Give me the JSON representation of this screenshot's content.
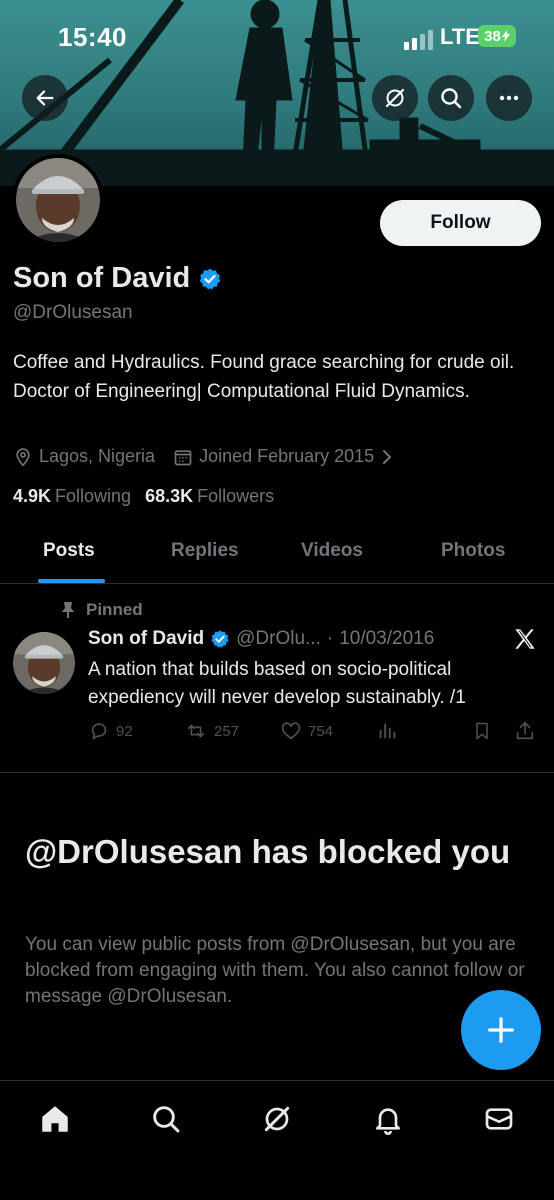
{
  "status_bar": {
    "time": "15:40",
    "network": "LTE",
    "battery": "38"
  },
  "header": {
    "back_icon": "arrow-left-icon",
    "grok_icon": "grok-icon",
    "search_icon": "search-icon",
    "more_icon": "more-horizontal-icon"
  },
  "profile": {
    "name": "Son of David",
    "handle": "@DrOlusesan",
    "follow_label": "Follow",
    "bio": "Coffee and Hydraulics. Found grace searching for crude oil. Doctor of Engineering| Computational Fluid Dynamics.",
    "location": "Lagos, Nigeria",
    "joined": "Joined February 2015",
    "following_count": "4.9K",
    "following_label": "Following",
    "followers_count": "68.3K",
    "followers_label": "Followers"
  },
  "tabs": [
    {
      "label": "Posts",
      "active": true
    },
    {
      "label": "Replies",
      "active": false
    },
    {
      "label": "Videos",
      "active": false
    },
    {
      "label": "Photos",
      "active": false
    }
  ],
  "pinned_post": {
    "pinned_label": "Pinned",
    "author": "Son of David",
    "handle": "@DrOlu...",
    "separator": "·",
    "date": "10/03/2016",
    "text": "A nation that builds based on socio-political expediency will never develop sustainably. /1",
    "replies": "92",
    "reposts": "257",
    "likes": "754"
  },
  "blocked": {
    "title": "@DrOlusesan has blocked you",
    "description": "You can view public posts from @DrOlusesan, but you are blocked from engaging with them. You also cannot follow or message @DrOlusesan."
  },
  "colors": {
    "accent": "#1d9bf0",
    "background": "#000000",
    "muted": "#71767b",
    "text": "#e7e9ea"
  },
  "bottom_nav": [
    "home-icon",
    "search-icon",
    "grok-icon",
    "notifications-icon",
    "messages-icon"
  ]
}
